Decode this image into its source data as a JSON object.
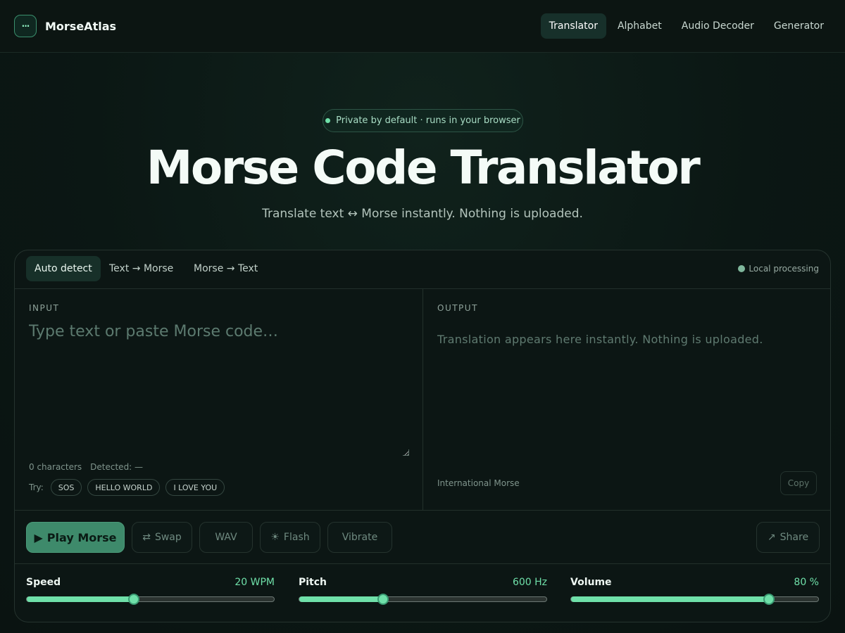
{
  "header": {
    "logo_glyph": "···",
    "brand": "MorseAtlas",
    "nav": [
      {
        "label": "Translator",
        "active": true
      },
      {
        "label": "Alphabet",
        "active": false
      },
      {
        "label": "Audio Decoder",
        "active": false
      },
      {
        "label": "Generator",
        "active": false
      }
    ]
  },
  "hero": {
    "badge": "Private by default · runs in your browser",
    "title": "Morse Code Translator",
    "subtitle": "Translate text ↔ Morse instantly. Nothing is uploaded."
  },
  "translator": {
    "tabs": [
      {
        "label": "Auto detect",
        "active": true
      },
      {
        "label": "Text → Morse",
        "active": false
      },
      {
        "label": "Morse → Text",
        "active": false
      }
    ],
    "local_status": "Local processing",
    "input": {
      "label": "INPUT",
      "placeholder": "Type text or paste Morse code…",
      "value": "",
      "char_count": "0 characters",
      "detected": "Detected: —",
      "try_label": "Try:",
      "examples": [
        "SOS",
        "HELLO WORLD",
        "I LOVE YOU"
      ]
    },
    "output": {
      "label": "OUTPUT",
      "placeholder": "Translation appears here instantly. Nothing is uploaded.",
      "standard": "International Morse",
      "copy_label": "Copy"
    },
    "actions": {
      "play": "Play Morse",
      "swap": "Swap",
      "wav": "WAV",
      "flash": "Flash",
      "vibrate": "Vibrate",
      "share": "Share"
    },
    "sliders": [
      {
        "name": "Speed",
        "value_text": "20 WPM",
        "level": 0.433
      },
      {
        "name": "Pitch",
        "value_text": "600 Hz",
        "level": 0.34
      },
      {
        "name": "Volume",
        "value_text": "80 %",
        "level": 0.8
      }
    ]
  },
  "colors": {
    "accent": "#6fe0a9",
    "play_button": "#3e8a6b",
    "background": "#0b1714"
  }
}
